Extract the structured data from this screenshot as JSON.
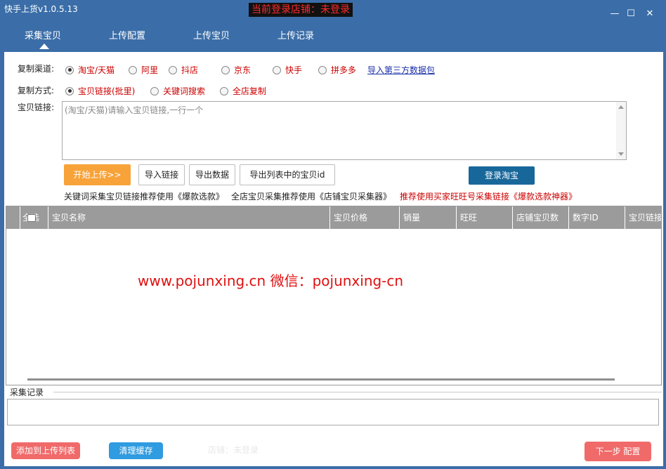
{
  "app": {
    "title": "快手上货v1.0.5.13",
    "login_status": "当前登录店铺：未登录"
  },
  "window_controls": {
    "minimize": "—",
    "maximize": "☐",
    "close": "✕"
  },
  "tabs": [
    {
      "label": "采集宝贝"
    },
    {
      "label": "上传配置"
    },
    {
      "label": "上传宝贝"
    },
    {
      "label": "上传记录"
    }
  ],
  "channel": {
    "label": "复制渠道:",
    "options": [
      {
        "label": "淘宝/天猫",
        "selected": true
      },
      {
        "label": "阿里",
        "selected": false
      },
      {
        "label": "抖店",
        "selected": false
      },
      {
        "label": "京东",
        "selected": false
      },
      {
        "label": "快手",
        "selected": false
      },
      {
        "label": "拼多多",
        "selected": false
      }
    ],
    "import_link": "导入第三方数据包"
  },
  "method": {
    "label": "复制方式:",
    "options": [
      {
        "label": "宝贝链接(批里)",
        "selected": true
      },
      {
        "label": "关键词搜索",
        "selected": false
      },
      {
        "label": "全店复制",
        "selected": false
      }
    ]
  },
  "links": {
    "label": "宝贝链接:",
    "placeholder": "(淘宝/天猫)请输入宝贝链接,一行一个",
    "value": ""
  },
  "buttons": {
    "start_upload": "开始上传>>",
    "import_links": "导入链接",
    "export_data": "导出数据",
    "export_ids": "导出列表中的宝贝id",
    "login_taobao": "登录淘宝"
  },
  "hints": {
    "keyword": "关键词采集宝贝链接推荐使用《爆款选款》",
    "shop": "全店宝贝采集推荐使用《店铺宝贝采集器》",
    "recommend": "推荐使用买家旺旺号采集链接《爆款选款神器》"
  },
  "table": {
    "select_all": "全选",
    "columns": [
      "宝贝名称",
      "宝贝价格",
      "销量",
      "旺旺",
      "店铺宝贝数",
      "数字ID",
      "宝贝链接"
    ],
    "rows": []
  },
  "watermark": "www.pojunxing.cn   微信：pojunxing-cn",
  "log": {
    "label": "采集记录",
    "value": ""
  },
  "footer": {
    "add_to_upload": "添加到上传列表",
    "clear_cache": "清理缓存",
    "status_text": "店铺：未登录",
    "next_step": "下一步 配置"
  },
  "colors": {
    "window_blue": "#3b6ea8",
    "accent_red": "#cc0000",
    "start_orange": "#f7a33a",
    "login_blue": "#18679a",
    "footer_red": "#f06a6a",
    "footer_blue": "#2f9be0"
  }
}
